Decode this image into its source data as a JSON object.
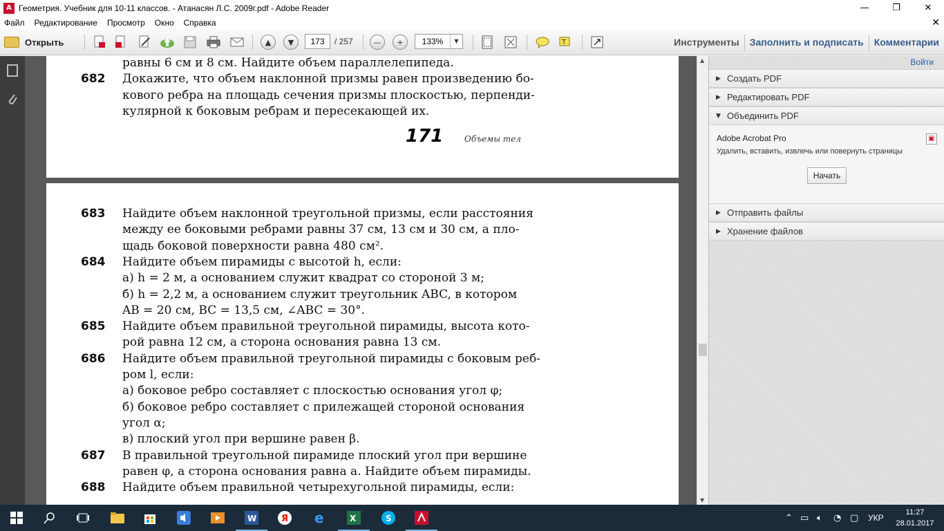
{
  "window": {
    "title": "Геометрия. Учебник для 10-11 классов. - Атанасян Л.С. 2009г.pdf - Adobe Reader",
    "app_icon_glyph": "A",
    "btn_minimize": "—",
    "btn_maximize": "❐",
    "btn_close": "✕"
  },
  "menu": {
    "items": [
      "Файл",
      "Редактирование",
      "Просмотр",
      "Окно",
      "Справка"
    ],
    "close_glyph": "✕"
  },
  "toolbar": {
    "open_label": "Открыть",
    "page_current": "173",
    "page_total": "/ 257",
    "zoom_value": "133%",
    "zoom_arrow": "▼",
    "glyph_zoom_out": "—",
    "glyph_zoom_in": "+",
    "glyph_prev": "▲",
    "glyph_next": "▼",
    "tools_label": "Инструменты",
    "fill_sign_label": "Заполнить и подписать",
    "comments_label": "Комментарии"
  },
  "page1": {
    "lines": [
      {
        "num": "",
        "text": "равны 6 см и 8 см. Найдите объем параллелепипеда."
      },
      {
        "num": "682",
        "text": "Докажите, что объем наклонной призмы равен произведению бо-"
      },
      {
        "num": "",
        "text": "кового ребра на площадь сечения призмы плоскостью, перпенди-"
      },
      {
        "num": "",
        "text": "кулярной к боковым ребрам и пересекающей их."
      }
    ],
    "footer_page_number": "171",
    "footer_label": "Объемы тел"
  },
  "page2": {
    "lines": [
      {
        "num": "683",
        "text": "Найдите объем наклонной треугольной призмы, если расстояния"
      },
      {
        "num": "",
        "text": "между ее боковыми ребрами равны 37 см, 13 см и 30 см, а пло-"
      },
      {
        "num": "",
        "text": "щадь боковой поверхности равна 480 см²."
      },
      {
        "num": "684",
        "text": "Найдите объем пирамиды с высотой h, если:"
      },
      {
        "num": "",
        "text": "а) h = 2 м, а основанием служит квадрат со стороной 3 м;"
      },
      {
        "num": "",
        "text": "б) h = 2,2 м, а основанием служит треугольник ABC, в котором"
      },
      {
        "num": "",
        "text": "AB = 20 см, BC = 13,5 см, ∠ABC = 30°."
      },
      {
        "num": "685",
        "text": "Найдите объем правильной треугольной пирамиды, высота кото-"
      },
      {
        "num": "",
        "text": "рой равна 12 см, а сторона основания равна 13 см."
      },
      {
        "num": "686",
        "text": "Найдите объем правильной треугольной пирамиды с боковым реб-"
      },
      {
        "num": "",
        "text": "ром l, если:"
      },
      {
        "num": "",
        "text": "а) боковое ребро составляет с плоскостью основания угол φ;"
      },
      {
        "num": "",
        "text": "б) боковое ребро составляет с прилежащей стороной основания"
      },
      {
        "num": "",
        "text": "угол α;"
      },
      {
        "num": "",
        "text": "в) плоский угол при вершине равен β."
      },
      {
        "num": "687",
        "text": "В правильной треугольной пирамиде плоский угол при вершине"
      },
      {
        "num": "",
        "text": "равен φ, а сторона основания равна a. Найдите объем пирамиды."
      },
      {
        "num": "688",
        "text": "Найдите объем правильной четырехугольной пирамиды, если:"
      }
    ]
  },
  "right_panel": {
    "login_label": "Войти",
    "items": [
      {
        "label": "Создать PDF",
        "arrow": "▶"
      },
      {
        "label": "Редактировать PDF",
        "arrow": "▶"
      },
      {
        "label": "Объединить PDF",
        "arrow": "▼"
      },
      {
        "label": "Отправить файлы",
        "arrow": "▶"
      },
      {
        "label": "Хранение файлов",
        "arrow": "▶"
      }
    ],
    "acrobat_title": "Adobe Acrobat Pro",
    "acrobat_desc": "Удалить, вставить, извлечь или повернуть страницы",
    "start_button": "Начать"
  },
  "taskbar": {
    "language": "УКР",
    "time": "11:27",
    "date": "28.01.2017"
  },
  "colors": {
    "doc_background": "#595959",
    "panel_link": "#3a5e8a",
    "taskbar": "#1c2b3a"
  }
}
